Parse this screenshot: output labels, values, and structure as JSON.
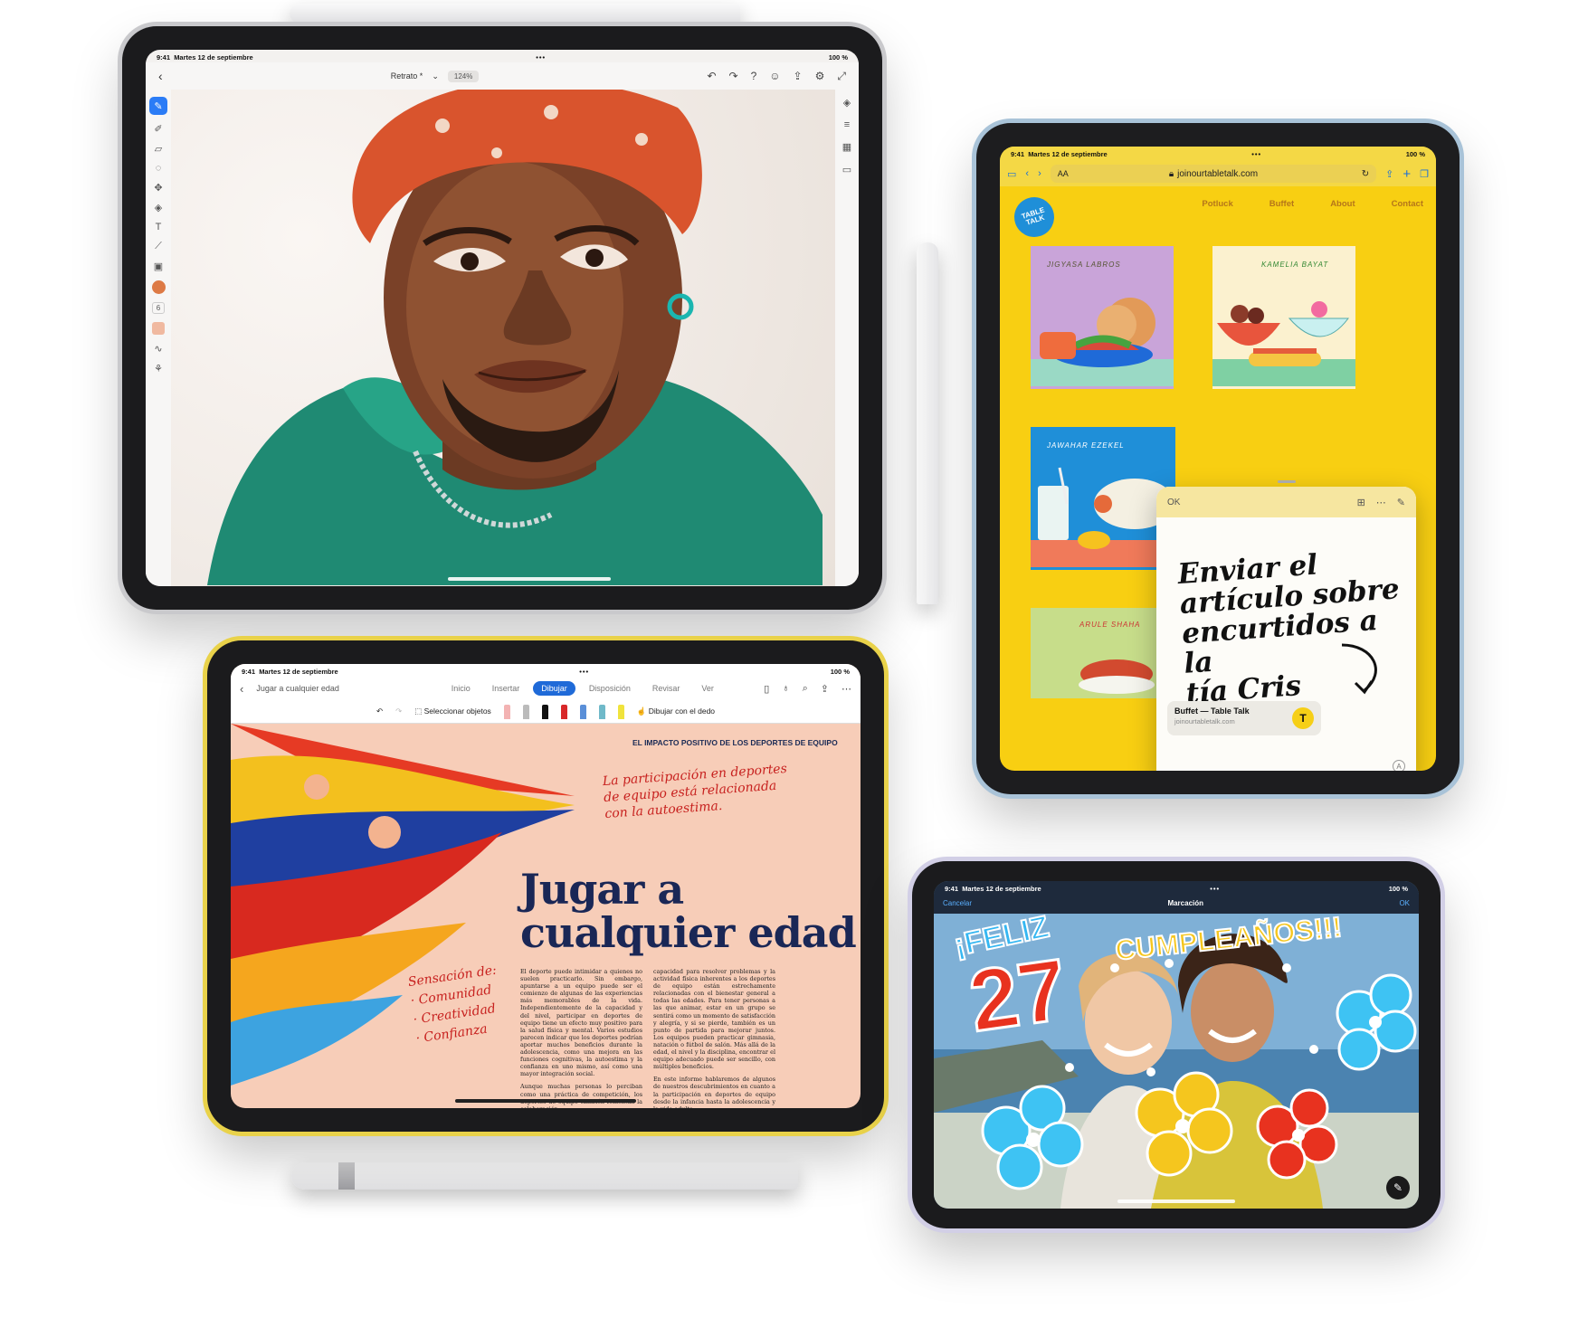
{
  "d1": {
    "status": {
      "time": "9:41",
      "date": "Martes 12 de septiembre",
      "battery": "100 %"
    },
    "back_icon": "chevron-left-icon",
    "doc_title": "Retrato *",
    "zoom": "124%",
    "toolbar_icons": [
      "undo-icon",
      "redo-icon",
      "help-icon",
      "user-icon",
      "share-icon",
      "settings-icon",
      "expand-icon"
    ],
    "left_tools": [
      "brush-icon",
      "smudge-icon",
      "eraser-icon",
      "lasso-icon",
      "transform-icon",
      "fill-icon",
      "text-icon",
      "eyedropper-icon",
      "image-icon"
    ],
    "text_tool": "T",
    "brush_size": "6",
    "right_tools": [
      "layers-icon",
      "adjust-icon",
      "grid-icon",
      "comment-icon"
    ],
    "colors": {
      "accent": "#2b7cf6",
      "swatch": "#dd7a45"
    }
  },
  "d2": {
    "status": {
      "time": "9:41",
      "date": "Martes 12 de septiembre",
      "battery": "100 %"
    },
    "aa": "AA",
    "url": "joinourtabletalk.com",
    "logo": "TABLE TALK",
    "nav": [
      "Potluck",
      "Buffet",
      "About",
      "Contact"
    ],
    "cards": [
      "JIGYASA LABROS",
      "KAMELIA BAYAT",
      "JAWAHAR EZEKEL",
      "ARULE SHAHA"
    ],
    "note": {
      "ok": "OK",
      "handwriting": [
        "Enviar el",
        "artículo sobre",
        "encurtidos a la",
        "tía Cris"
      ],
      "link_title": "Buffet — Table Talk",
      "link_url": "joinourtabletalk.com",
      "badge": "T"
    },
    "colors": {
      "bg": "#f8cf12",
      "link": "#b5761a"
    }
  },
  "d3": {
    "status": {
      "time": "9:41",
      "date": "Martes 12 de septiembre",
      "battery": "100 %"
    },
    "doc_title": "Jugar a cualquier edad",
    "tabs": [
      "Inicio",
      "Insertar",
      "Dibujar",
      "Disposición",
      "Revisar",
      "Ver"
    ],
    "active_tab": "Dibujar",
    "select_objects": "Seleccionar objetos",
    "finger_draw": "Dibujar con el dedo",
    "kicker": "EL IMPACTO POSITIVO DE LOS DEPORTES DE EQUIPO",
    "scribble": [
      "La participación en deportes",
      "de equipo está relacionada",
      "con la autoestima."
    ],
    "headline": [
      "Jugar a",
      "cualquier edad"
    ],
    "side_scribble": [
      "Sensación de:",
      "· Comunidad",
      "· Creatividad",
      "· Confianza"
    ],
    "col1": "El deporte puede intimidar a quienes no suelen practicarlo. Sin embargo, apuntarse a un equipo puede ser el comienzo de algunas de las experiencias más memorables de la vida. Independientemente de la capacidad y del nivel, participar en deportes de equipo tiene un efecto muy positivo para la salud física y mental. Varios estudios parecen indicar que los deportes podrían aportar muchos beneficios durante la adolescencia, como una mejora en las funciones cognitivas, la autoestima y la confianza en uno mismo, así como una mayor integración social.",
    "col1b": "Aunque muchas personas lo perciban como una práctica de competición, los deportes de equipo también fomentan la colaboración.",
    "col2": "capacidad para resolver problemas y la actividad física inherentes a los deportes de equipo están estrechamente relacionadas con el bienestar general a todas las edades. Para tener personas a las que animar, estar en un grupo se sentirá como un momento de satisfacción y alegría, y si se pierde, también es un punto de partida para mejorar juntos. Los equipos pueden practicar gimnasia, natación o fútbol de salón. Más allá de la edad, el nivel y la disciplina, encontrar el equipo adecuado puede ser sencillo, con múltiples beneficios.",
    "col2b": "En este informe hablaremos de algunos de nuestros descubrimientos en cuanto a la participación en deportes de equipo desde la infancia hasta la adolescencia y la vida adulta.",
    "colors": {
      "accent": "#1f6ad8",
      "headline": "#1a2756",
      "scribble": "#c7201e"
    }
  },
  "d4": {
    "status": {
      "time": "9:41",
      "date": "Martes 12 de septiembre",
      "battery": "100 %"
    },
    "cancel": "Cancelar",
    "title": "Marcación",
    "ok": "OK",
    "feliz": "¡FELIZ",
    "cumple": "CUMPLEAÑOS!!!",
    "number": "27",
    "markup_icon": "pen-tip-icon"
  }
}
